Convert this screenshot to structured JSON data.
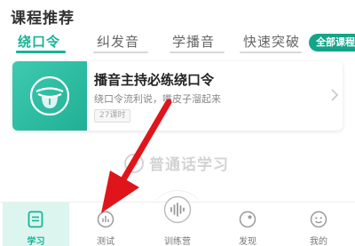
{
  "header": {
    "section_title": "课程推荐"
  },
  "tabs": [
    {
      "label": "绕口令",
      "active": true
    },
    {
      "label": "纠发音",
      "active": false
    },
    {
      "label": "学播音",
      "active": false
    },
    {
      "label": "快速突破",
      "active": false
    }
  ],
  "all_courses_button": "全部课程",
  "course": {
    "title": "播音主持必练绕口令",
    "description": "绕口令流利说，嘴皮子溜起来",
    "lessons": "27课时"
  },
  "watermark": "普通话学习",
  "bottom_nav": [
    {
      "label": "学习",
      "icon": "book-icon",
      "active": true
    },
    {
      "label": "测试",
      "icon": "chart-icon",
      "active": false
    },
    {
      "label": "训练营",
      "icon": "voice-wave-icon",
      "active": false
    },
    {
      "label": "发现",
      "icon": "discover-icon",
      "active": false
    },
    {
      "label": "我的",
      "icon": "profile-icon",
      "active": false
    }
  ],
  "colors": {
    "accent": "#19b396",
    "accent_dark": "#14a48a",
    "annotation": "#e0151b"
  }
}
